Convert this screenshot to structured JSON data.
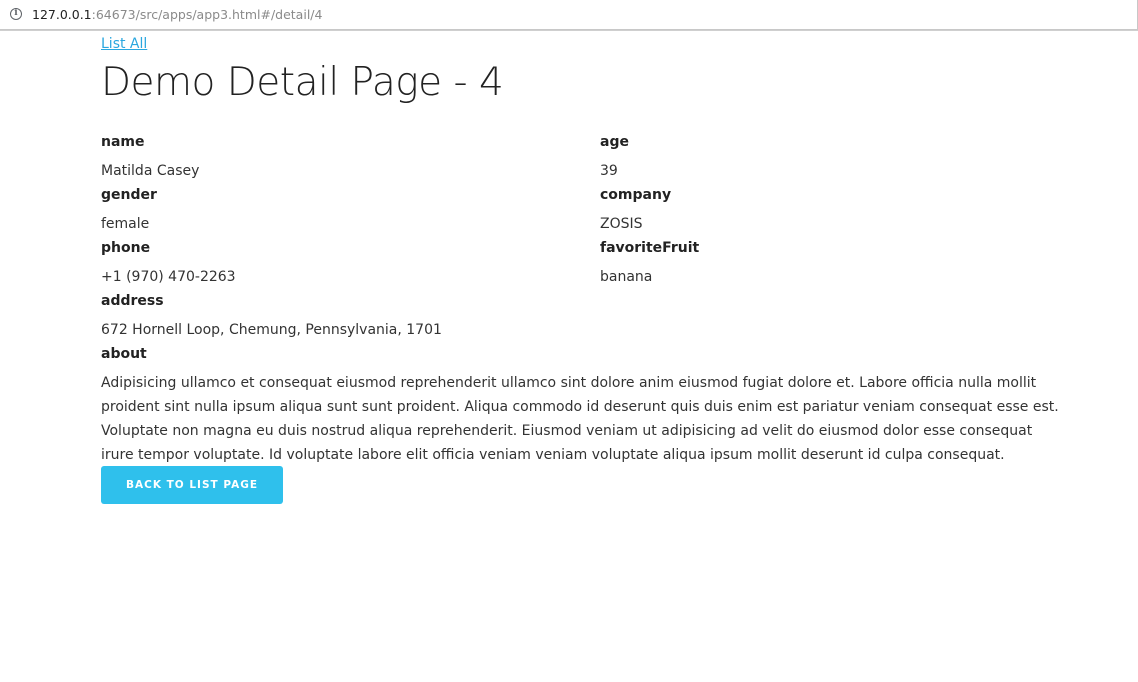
{
  "browser": {
    "url_host": "127.0.0.1",
    "url_rest": ":64673/src/apps/app3.html#/detail/4",
    "info_icon": "info-circle-icon"
  },
  "nav": {
    "list_all_label": "List All"
  },
  "page": {
    "title": "Demo Detail Page - 4"
  },
  "fields": {
    "name": {
      "label": "name",
      "value": "Matilda Casey"
    },
    "age": {
      "label": "age",
      "value": "39"
    },
    "gender": {
      "label": "gender",
      "value": "female"
    },
    "company": {
      "label": "company",
      "value": "ZOSIS"
    },
    "phone": {
      "label": "phone",
      "value": "+1 (970) 470-2263"
    },
    "favoriteFruit": {
      "label": "favoriteFruit",
      "value": "banana"
    },
    "address": {
      "label": "address",
      "value": "672 Hornell Loop, Chemung, Pennsylvania, 1701"
    },
    "about": {
      "label": "about",
      "value": "Adipisicing ullamco et consequat eiusmod reprehenderit ullamco sint dolore anim eiusmod fugiat dolore et. Labore officia nulla mollit proident sint nulla ipsum aliqua sunt sunt proident. Aliqua commodo id deserunt quis duis enim est pariatur veniam consequat esse est. Voluptate non magna eu duis nostrud aliqua reprehenderit. Eiusmod veniam ut adipisicing ad velit do eiusmod dolor esse consequat irure tempor voluptate. Id voluptate labore elit officia veniam veniam voluptate aliqua ipsum mollit deserunt id culpa consequat."
    }
  },
  "actions": {
    "back_label": "BACK TO LIST PAGE"
  },
  "colors": {
    "link": "#2aa7df",
    "button": "#2fc0ec"
  }
}
